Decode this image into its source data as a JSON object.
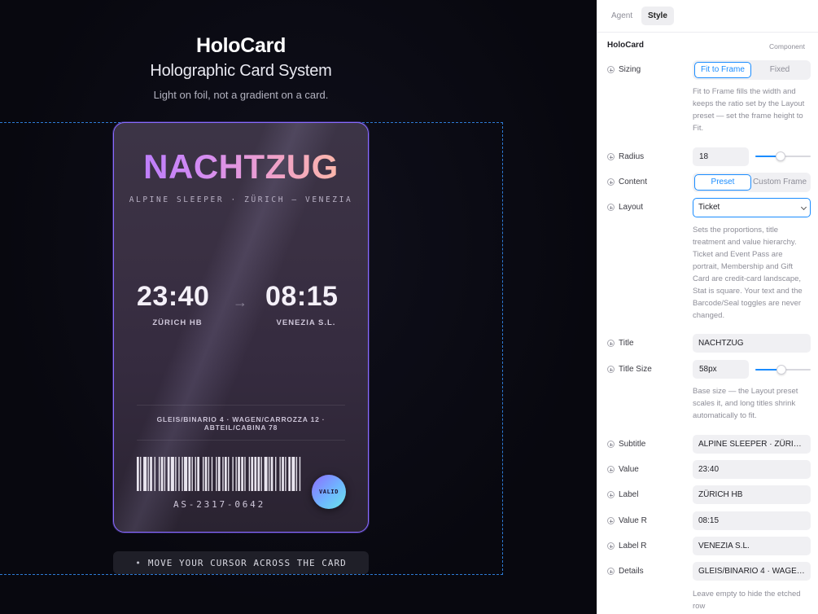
{
  "canvas": {
    "title": "HoloCard",
    "subtitle": "Holographic Card System",
    "tagline": "Light on foil, not a gradient on a card.",
    "hint": "MOVE YOUR CURSOR ACROSS THE CARD",
    "hint_bullet": "•"
  },
  "card": {
    "title": "NACHTZUG",
    "subtitle": "ALPINE SLEEPER · ZÜRICH — VENEZIA",
    "value": "23:40",
    "label": "ZÜRICH HB",
    "arrow": "→",
    "value_r": "08:15",
    "label_r": "VENEZIA S.L.",
    "details": "GLEIS/BINARIO 4 · WAGEN/CARROZZA 12 · ABTEIL/CABINA 78",
    "serial": "AS-2317-0642",
    "seal": "VALID",
    "accent": "#8a6cff"
  },
  "panel": {
    "tabs": [
      "Agent",
      "Style"
    ],
    "active_tab": "Style",
    "header": "HoloCard",
    "header_meta": "Component",
    "sizing": {
      "label": "Sizing",
      "options": [
        "Fit to Frame",
        "Fixed"
      ],
      "selected": "Fit to Frame",
      "help": "Fit to Frame fills the width and keeps the ratio set by the Layout preset — set the frame height to Fit."
    },
    "radius": {
      "label": "Radius",
      "value": "18",
      "level": 0.45
    },
    "content": {
      "label": "Content",
      "options": [
        "Preset",
        "Custom Frame"
      ],
      "selected": "Preset"
    },
    "layout": {
      "label": "Layout",
      "value": "Ticket",
      "help": "Sets the proportions, title treatment and value hierarchy. Ticket and Event Pass are portrait, Membership and Gift Card are credit-card landscape, Stat is square. Your text and the Barcode/Seal toggles are never changed."
    },
    "title": {
      "label": "Title",
      "value": "NACHTZUG"
    },
    "title_size": {
      "label": "Title Size",
      "value": "58px",
      "level": 0.47,
      "help": "Base size — the Layout preset scales it, and long titles shrink automatically to fit."
    },
    "subtitle": {
      "label": "Subtitle",
      "value": "ALPINE SLEEPER · ZÜRICH ..."
    },
    "value": {
      "label": "Value",
      "value": "23:40"
    },
    "label": {
      "label": "Label",
      "value": "ZÜRICH HB"
    },
    "value_r": {
      "label": "Value R",
      "value": "08:15"
    },
    "label_r": {
      "label": "Label R",
      "value": "VENEZIA S.L."
    },
    "details": {
      "label": "Details",
      "value": "GLEIS/BINARIO 4 · WAGEN...",
      "help": "Leave empty to hide the etched row"
    },
    "accent": "#1a8cff"
  }
}
